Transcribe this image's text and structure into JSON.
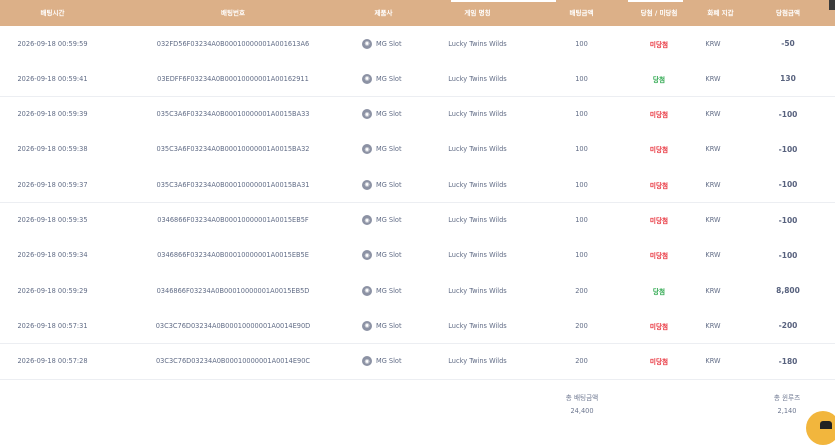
{
  "header": {
    "bet_time": "배팅시간",
    "bet_number": "배팅번호",
    "provider": "제품사",
    "game_name": "게임 명칭",
    "bet_amount": "배팅금액",
    "result": "당첨 / 미당첨",
    "currency": "화폐 지갑",
    "win_amount": "당첨금액"
  },
  "rows": [
    {
      "time": "2026-09-18 00:59:59",
      "id": "032FD56F03234A0B00010000001A001613A6",
      "provider": "MG Slot",
      "game": "Lucky Twins Wilds",
      "bet": "100",
      "result": "미당첨",
      "result_type": "lose",
      "currency": "KRW",
      "amount": "-50"
    },
    {
      "time": "2026-09-18 00:59:41",
      "id": "03EDFF6F03234A0B00010000001A00162911",
      "provider": "MG Slot",
      "game": "Lucky Twins Wilds",
      "bet": "100",
      "result": "당첨",
      "result_type": "win",
      "currency": "KRW",
      "amount": "130"
    },
    {
      "time": "2026-09-18 00:59:39",
      "id": "035C3A6F03234A0B00010000001A0015BA33",
      "provider": "MG Slot",
      "game": "Lucky Twins Wilds",
      "bet": "100",
      "result": "미당첨",
      "result_type": "lose",
      "currency": "KRW",
      "amount": "-100"
    },
    {
      "time": "2026-09-18 00:59:38",
      "id": "035C3A6F03234A0B00010000001A0015BA32",
      "provider": "MG Slot",
      "game": "Lucky Twins Wilds",
      "bet": "100",
      "result": "미당첨",
      "result_type": "lose",
      "currency": "KRW",
      "amount": "-100"
    },
    {
      "time": "2026-09-18 00:59:37",
      "id": "035C3A6F03234A0B00010000001A0015BA31",
      "provider": "MG Slot",
      "game": "Lucky Twins Wilds",
      "bet": "100",
      "result": "미당첨",
      "result_type": "lose",
      "currency": "KRW",
      "amount": "-100"
    },
    {
      "time": "2026-09-18 00:59:35",
      "id": "0346866F03234A0B00010000001A0015EB5F",
      "provider": "MG Slot",
      "game": "Lucky Twins Wilds",
      "bet": "100",
      "result": "미당첨",
      "result_type": "lose",
      "currency": "KRW",
      "amount": "-100"
    },
    {
      "time": "2026-09-18 00:59:34",
      "id": "0346866F03234A0B00010000001A0015EB5E",
      "provider": "MG Slot",
      "game": "Lucky Twins Wilds",
      "bet": "100",
      "result": "미당첨",
      "result_type": "lose",
      "currency": "KRW",
      "amount": "-100"
    },
    {
      "time": "2026-09-18 00:59:29",
      "id": "0346866F03234A0B00010000001A0015EB5D",
      "provider": "MG Slot",
      "game": "Lucky Twins Wilds",
      "bet": "200",
      "result": "당첨",
      "result_type": "win",
      "currency": "KRW",
      "amount": "8,800"
    },
    {
      "time": "2026-09-18 00:57:31",
      "id": "03C3C76D03234A0B00010000001A0014E90D",
      "provider": "MG Slot",
      "game": "Lucky Twins Wilds",
      "bet": "200",
      "result": "미당첨",
      "result_type": "lose",
      "currency": "KRW",
      "amount": "-200"
    },
    {
      "time": "2026-09-18 00:57:28",
      "id": "03C3C76D03234A0B00010000001A0014E90C",
      "provider": "MG Slot",
      "game": "Lucky Twins Wilds",
      "bet": "200",
      "result": "미당첨",
      "result_type": "lose",
      "currency": "KRW",
      "amount": "-180"
    }
  ],
  "summary": {
    "total_bet_label": "총 배팅금액",
    "total_bet_value": "24,400",
    "total_win_label": "총 윈루즈",
    "total_win_value": "2,140"
  },
  "colors": {
    "header_bg": "#dcb088",
    "lose": "#e8323c",
    "win": "#2ea84f",
    "chat": "#f2b63d"
  },
  "icons": {
    "provider": "mg-logo-icon",
    "chat": "chat-bubble-icon"
  }
}
